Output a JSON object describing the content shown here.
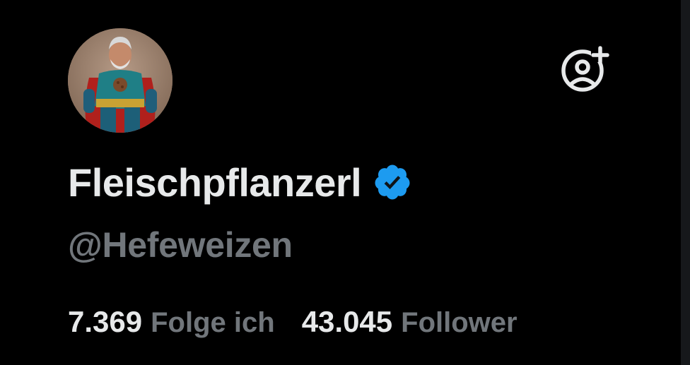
{
  "profile": {
    "display_name": "Fleischpflanzerl",
    "handle": "@Hefeweizen",
    "verified": true,
    "avatar": "superhero-portrait"
  },
  "actions": {
    "follow_icon": "user-plus-icon"
  },
  "stats": {
    "following_value": "7.369",
    "following_label": "Folge ich",
    "followers_value": "43.045",
    "followers_label": "Follower"
  },
  "colors": {
    "background": "#000000",
    "primary_text": "#e7e9ea",
    "secondary_text": "#71767b",
    "verified_blue": "#1d9bf0"
  }
}
